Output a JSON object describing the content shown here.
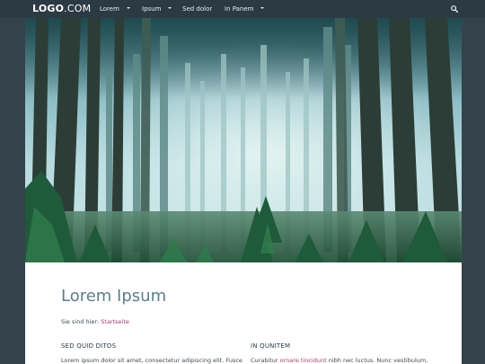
{
  "header": {
    "logo_main": "LOGO",
    "logo_suffix": ".COM",
    "nav": [
      {
        "label": "Lorem",
        "has_dropdown": true
      },
      {
        "label": "Ipsum",
        "has_dropdown": true
      },
      {
        "label": "Sed dolor",
        "has_dropdown": false
      },
      {
        "label": "In Panem",
        "has_dropdown": true
      }
    ],
    "search_icon": "search-icon"
  },
  "hero": {
    "image": "forest-scene"
  },
  "content": {
    "title": "Lorem Ipsum",
    "breadcrumb_prefix": "Sie sind hier:",
    "breadcrumb_link": "Startseite",
    "columns": [
      {
        "title": "SED QUID DITOS",
        "text": "Lorem ipsum dolor sit amet, consectetur adipiscing elit. Fusce"
      },
      {
        "title": "IN QUNITEM",
        "text_before": "Curabitur ",
        "text_link": "ornare tincidunt",
        "text_after": " nibh nec luctus. Nunc vestibulum,"
      }
    ]
  },
  "colors": {
    "background": "#34424c",
    "topbar": "#2c3a44",
    "title": "#5c7d8c",
    "link": "#a23a6e"
  }
}
